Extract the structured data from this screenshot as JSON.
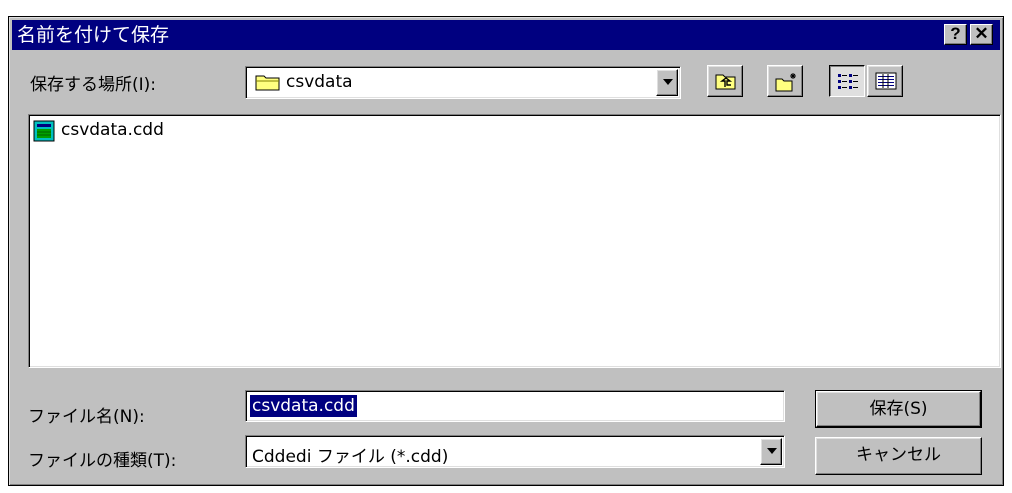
{
  "dialog": {
    "title": "名前を付けて保存",
    "help_button": "?",
    "close_button": "✕"
  },
  "save_in": {
    "label": "保存する場所(I):",
    "value": "csvdata",
    "folder_icon": "folder-icon"
  },
  "toolbar": {
    "up_one_level_icon": "up-folder-icon",
    "new_folder_icon": "new-folder-icon",
    "list_view_icon": "list-view-icon",
    "details_view_icon": "details-view-icon"
  },
  "file_list": {
    "items": [
      {
        "name": "csvdata.cdd",
        "icon": "cdd-file-icon"
      }
    ]
  },
  "file_name": {
    "label": "ファイル名(N):",
    "value": "csvdata.cdd"
  },
  "file_type": {
    "label": "ファイルの種類(T):",
    "value": "Cddedi ファイル (*.cdd)"
  },
  "buttons": {
    "save": "保存(S)",
    "cancel": "キャンセル"
  },
  "colors": {
    "face": "#c0c0c0",
    "titlebar": "#000080",
    "selection": "#000080"
  }
}
